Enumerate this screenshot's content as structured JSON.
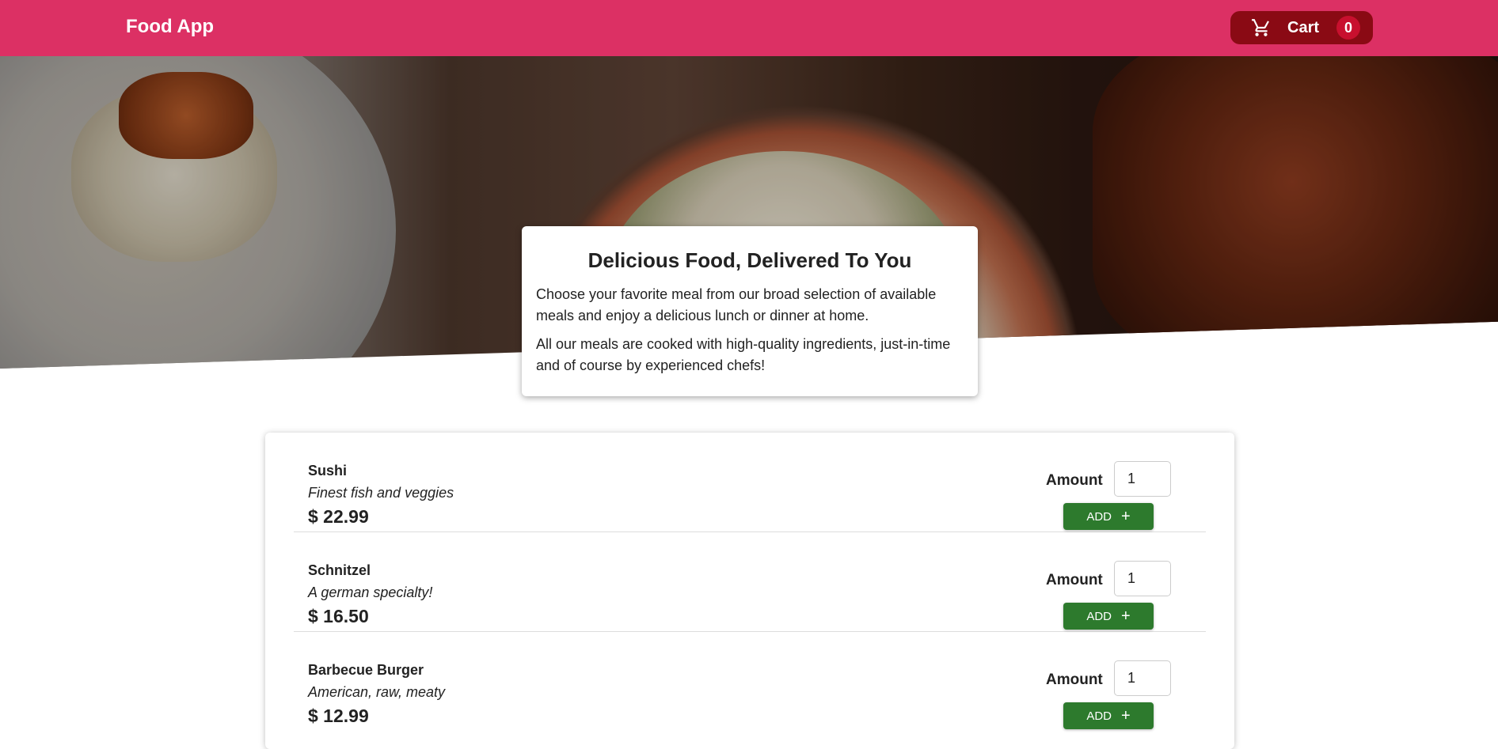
{
  "header": {
    "title": "Food App",
    "cart": {
      "label": "Cart",
      "count": "0",
      "icon": "cart-icon"
    }
  },
  "colors": {
    "header_bg": "#dc3064",
    "cart_bg": "#8a0a14",
    "badge_bg": "#c8102e",
    "add_button_bg": "#2d7a2d"
  },
  "summary": {
    "title": "Delicious Food, Delivered To You",
    "paragraph1": "Choose your favorite meal from our broad selection of available meals and enjoy a delicious lunch or dinner at home.",
    "paragraph2": "All our meals are cooked with high-quality ingredients, just-in-time and of course by experienced chefs!"
  },
  "meals": [
    {
      "name": "Sushi",
      "description": "Finest fish and veggies",
      "price": "$ 22.99",
      "amount_label": "Amount",
      "amount_value": "1",
      "add_label": "ADD",
      "add_icon": "+"
    },
    {
      "name": "Schnitzel",
      "description": "A german specialty!",
      "price": "$ 16.50",
      "amount_label": "Amount",
      "amount_value": "1",
      "add_label": "ADD",
      "add_icon": "+"
    },
    {
      "name": "Barbecue Burger",
      "description": "American, raw, meaty",
      "price": "$ 12.99",
      "amount_label": "Amount",
      "amount_value": "1",
      "add_label": "ADD",
      "add_icon": "+"
    }
  ]
}
